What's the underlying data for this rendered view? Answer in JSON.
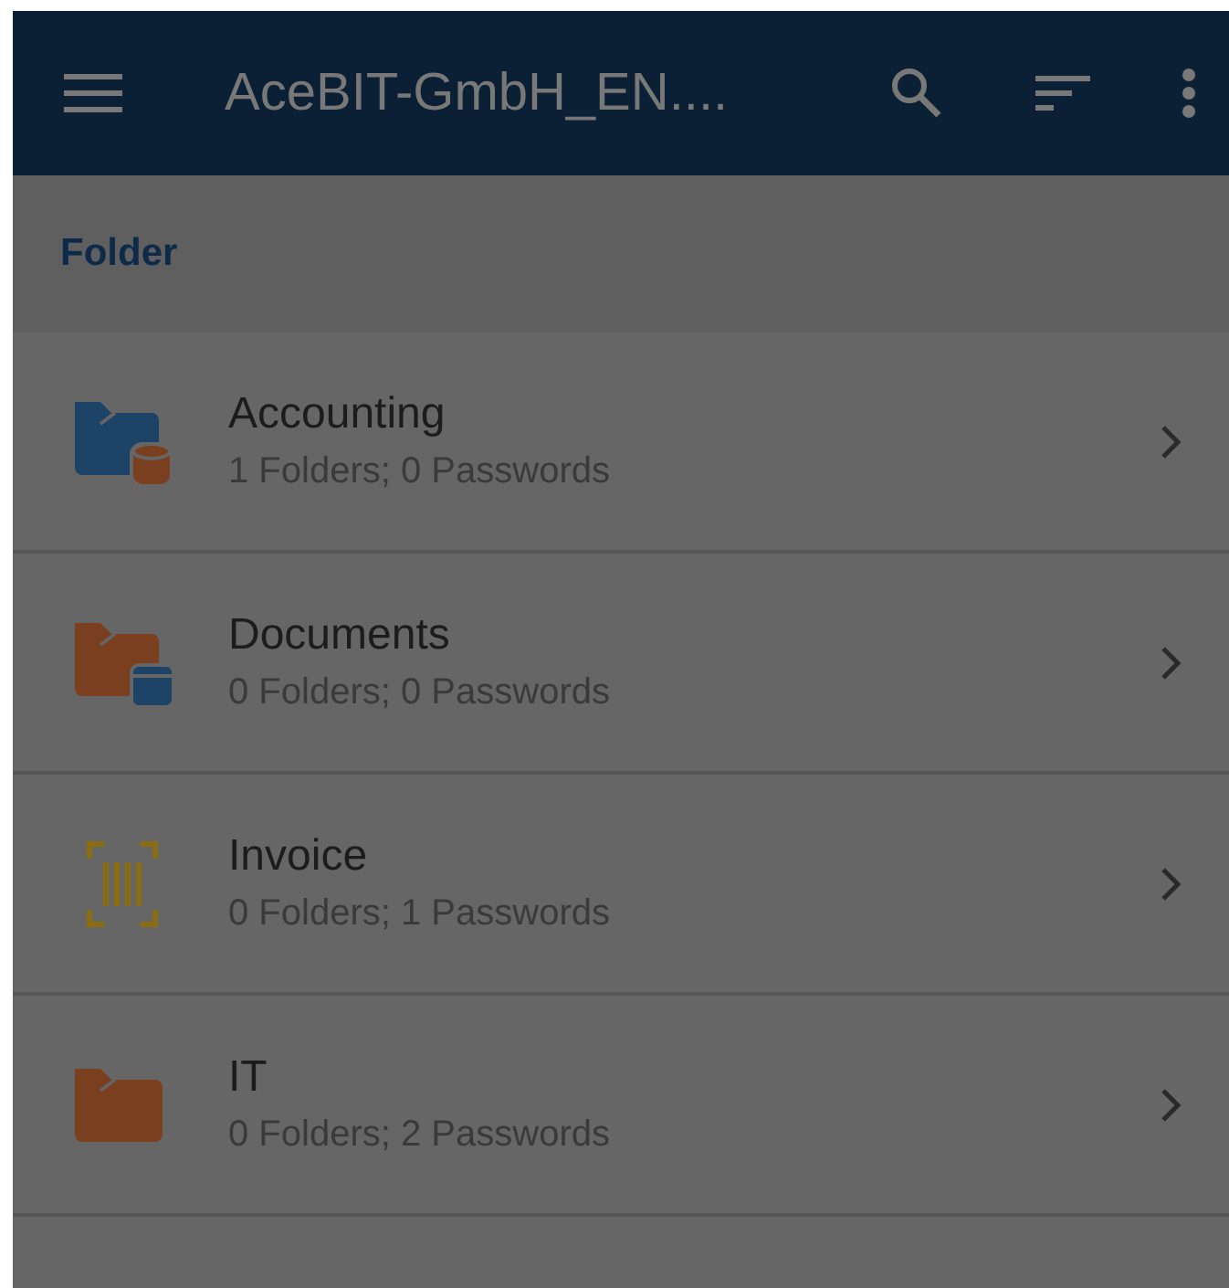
{
  "app_bar": {
    "title": "AceBIT-GmbH_EN...."
  },
  "section": {
    "label": "Folder"
  },
  "items": [
    {
      "kind": "folder-database",
      "title": "Accounting",
      "subtitle": "1 Folders; 0 Passwords"
    },
    {
      "kind": "folder-window",
      "title": "Documents",
      "subtitle": "0 Folders; 0 Passwords"
    },
    {
      "kind": "barcode",
      "title": "Invoice",
      "subtitle": "0 Folders; 1 Passwords"
    },
    {
      "kind": "folder",
      "title": "IT",
      "subtitle": "0 Folders; 2 Passwords"
    }
  ]
}
